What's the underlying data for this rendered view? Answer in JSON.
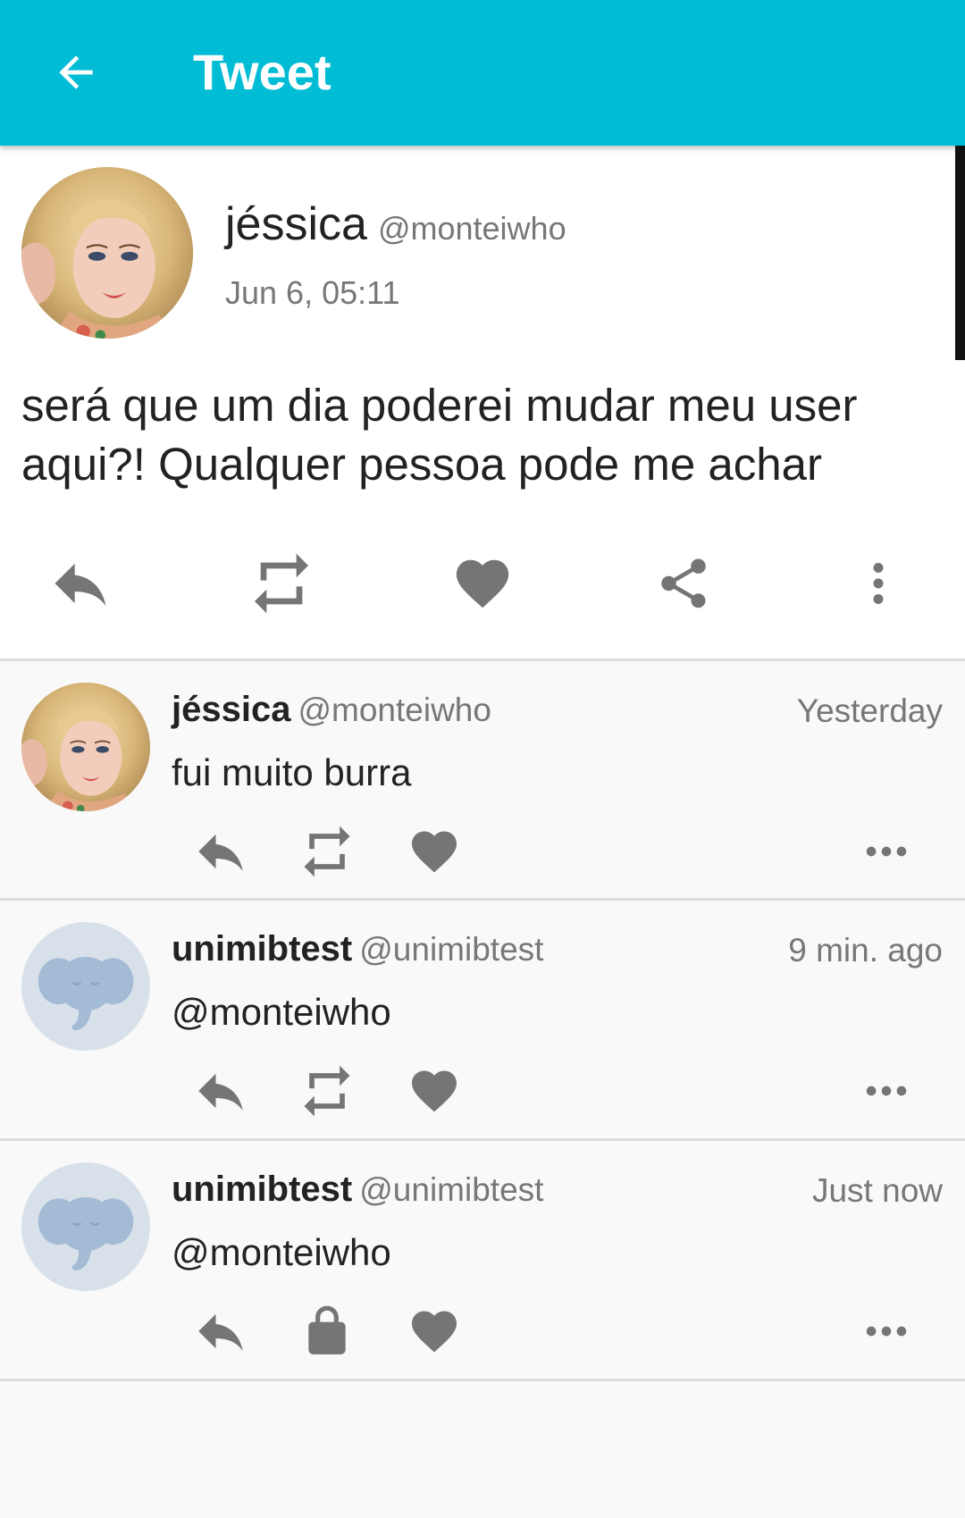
{
  "appbar": {
    "title": "Tweet",
    "back_icon": "arrow-left-icon",
    "background": "#00bcd4"
  },
  "tweet": {
    "name": "jéssica",
    "handle": "@monteiwho",
    "date": "Jun 6, 05:11",
    "text": "será que um dia poderei mudar meu user aqui?! Qualquer pessoa pode me achar",
    "actions": [
      "reply-icon",
      "retweet-icon",
      "heart-icon",
      "share-icon",
      "more-vertical-icon"
    ]
  },
  "replies": [
    {
      "name": "jéssica",
      "handle": "@monteiwho",
      "time": "Yesterday",
      "text": "fui muito burra",
      "avatar": "photo",
      "actions": [
        "reply-icon",
        "retweet-icon",
        "heart-icon",
        "more-horizontal-icon"
      ]
    },
    {
      "name": "unimibtest",
      "handle": "@unimibtest",
      "time": "9 min. ago",
      "text": "@monteiwho",
      "avatar": "elephant",
      "actions": [
        "reply-icon",
        "retweet-icon",
        "heart-icon",
        "more-horizontal-icon"
      ]
    },
    {
      "name": "unimibtest",
      "handle": "@unimibtest",
      "time": "Just now",
      "text": "@monteiwho",
      "avatar": "elephant",
      "actions": [
        "reply-icon",
        "lock-icon",
        "heart-icon",
        "more-horizontal-icon"
      ]
    }
  ],
  "colors": {
    "accent": "#00bcd4",
    "icon": "#757575",
    "elephant_bg": "#d8e1ea",
    "elephant": "#a4bbd6"
  }
}
